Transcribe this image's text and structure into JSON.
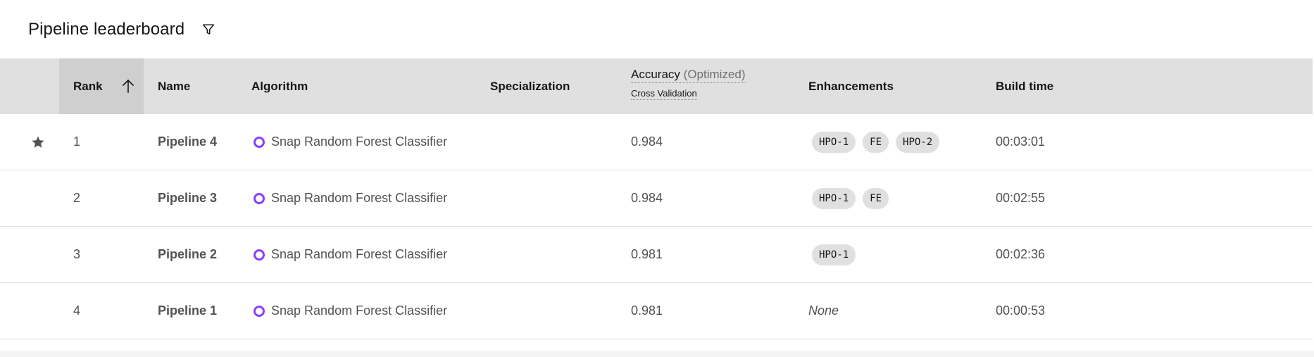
{
  "header": {
    "title": "Pipeline leaderboard",
    "filter_icon": "filter-icon"
  },
  "table": {
    "columns": {
      "rank": "Rank",
      "name": "Name",
      "algorithm": "Algorithm",
      "specialization": "Specialization",
      "accuracy": "Accuracy",
      "accuracy_qualifier": "(Optimized)",
      "accuracy_sub": "Cross Validation",
      "enhancements": "Enhancements",
      "build_time": "Build time"
    },
    "sort": {
      "column": "rank",
      "direction": "ascending",
      "icon": "arrow-up-icon"
    },
    "rows": [
      {
        "starred": true,
        "rank": "1",
        "name": "Pipeline 4",
        "algorithm": "Snap Random Forest Classifier",
        "specialization": "",
        "accuracy": "0.984",
        "enhancements": [
          "HPO-1",
          "FE",
          "HPO-2"
        ],
        "build_time": "00:03:01"
      },
      {
        "starred": false,
        "rank": "2",
        "name": "Pipeline 3",
        "algorithm": "Snap Random Forest Classifier",
        "specialization": "",
        "accuracy": "0.984",
        "enhancements": [
          "HPO-1",
          "FE"
        ],
        "build_time": "00:02:55"
      },
      {
        "starred": false,
        "rank": "3",
        "name": "Pipeline 2",
        "algorithm": "Snap Random Forest Classifier",
        "specialization": "",
        "accuracy": "0.981",
        "enhancements": [
          "HPO-1"
        ],
        "build_time": "00:02:36"
      },
      {
        "starred": false,
        "rank": "4",
        "name": "Pipeline 1",
        "algorithm": "Snap Random Forest Classifier",
        "specialization": "",
        "accuracy": "0.981",
        "enhancements": [],
        "enhancements_empty": "None",
        "build_time": "00:00:53"
      }
    ]
  },
  "colors": {
    "header_bg": "#e0e0e0",
    "sorted_column_bg": "#cfcfcf",
    "algorithm_dot": "#8a3ffc",
    "tag_bg": "#e0e0e0"
  }
}
